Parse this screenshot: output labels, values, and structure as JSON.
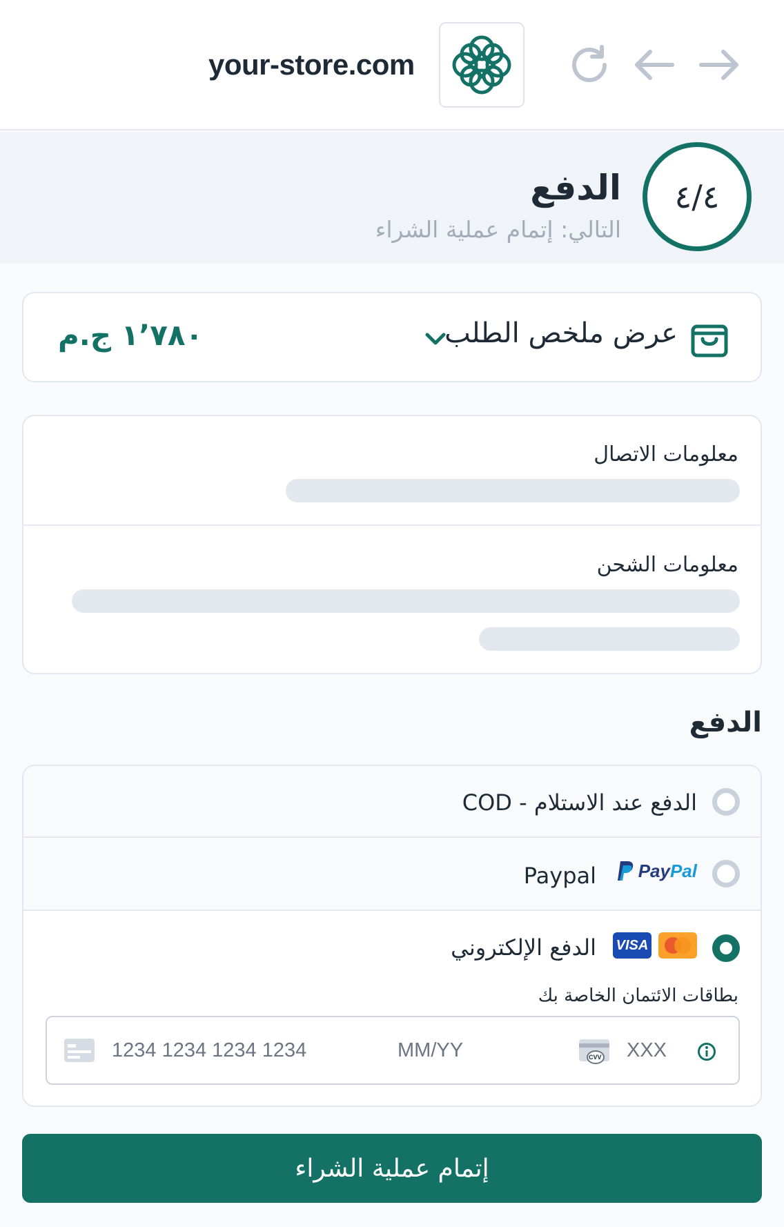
{
  "browser": {
    "domain": "your-store.com"
  },
  "step": {
    "title": "الدفع",
    "next_label": "التالي: إتمام عملية الشراء",
    "progress": "٤/٤"
  },
  "summary": {
    "label": "عرض ملخص الطلب",
    "total": "١٬٧٨٠ ج.م"
  },
  "info": {
    "contact_title": "معلومات الاتصال",
    "shipping_title": "معلومات الشحن"
  },
  "payment": {
    "section_title": "الدفع",
    "options": [
      {
        "label": "الدفع عند الاستلام - COD",
        "selected": false
      },
      {
        "label": "Paypal",
        "brand": "PayPal",
        "selected": false
      },
      {
        "label": "الدفع الإلكتروني",
        "brands": [
          "VISA",
          "mastercard"
        ],
        "selected": true
      }
    ],
    "cards_hint": "بطاقات الائتمان الخاصة بك",
    "card_number_placeholder": "1234 1234 1234 1234",
    "expiry_placeholder": "MM/YY",
    "cvc_placeholder": "XXX",
    "cvv_icon_text": "CVV"
  },
  "submit": {
    "label": "إتمام عملية الشراء"
  },
  "colors": {
    "brand": "#137265",
    "muted": "#a3acb8",
    "skeleton": "#e3e8ef"
  }
}
